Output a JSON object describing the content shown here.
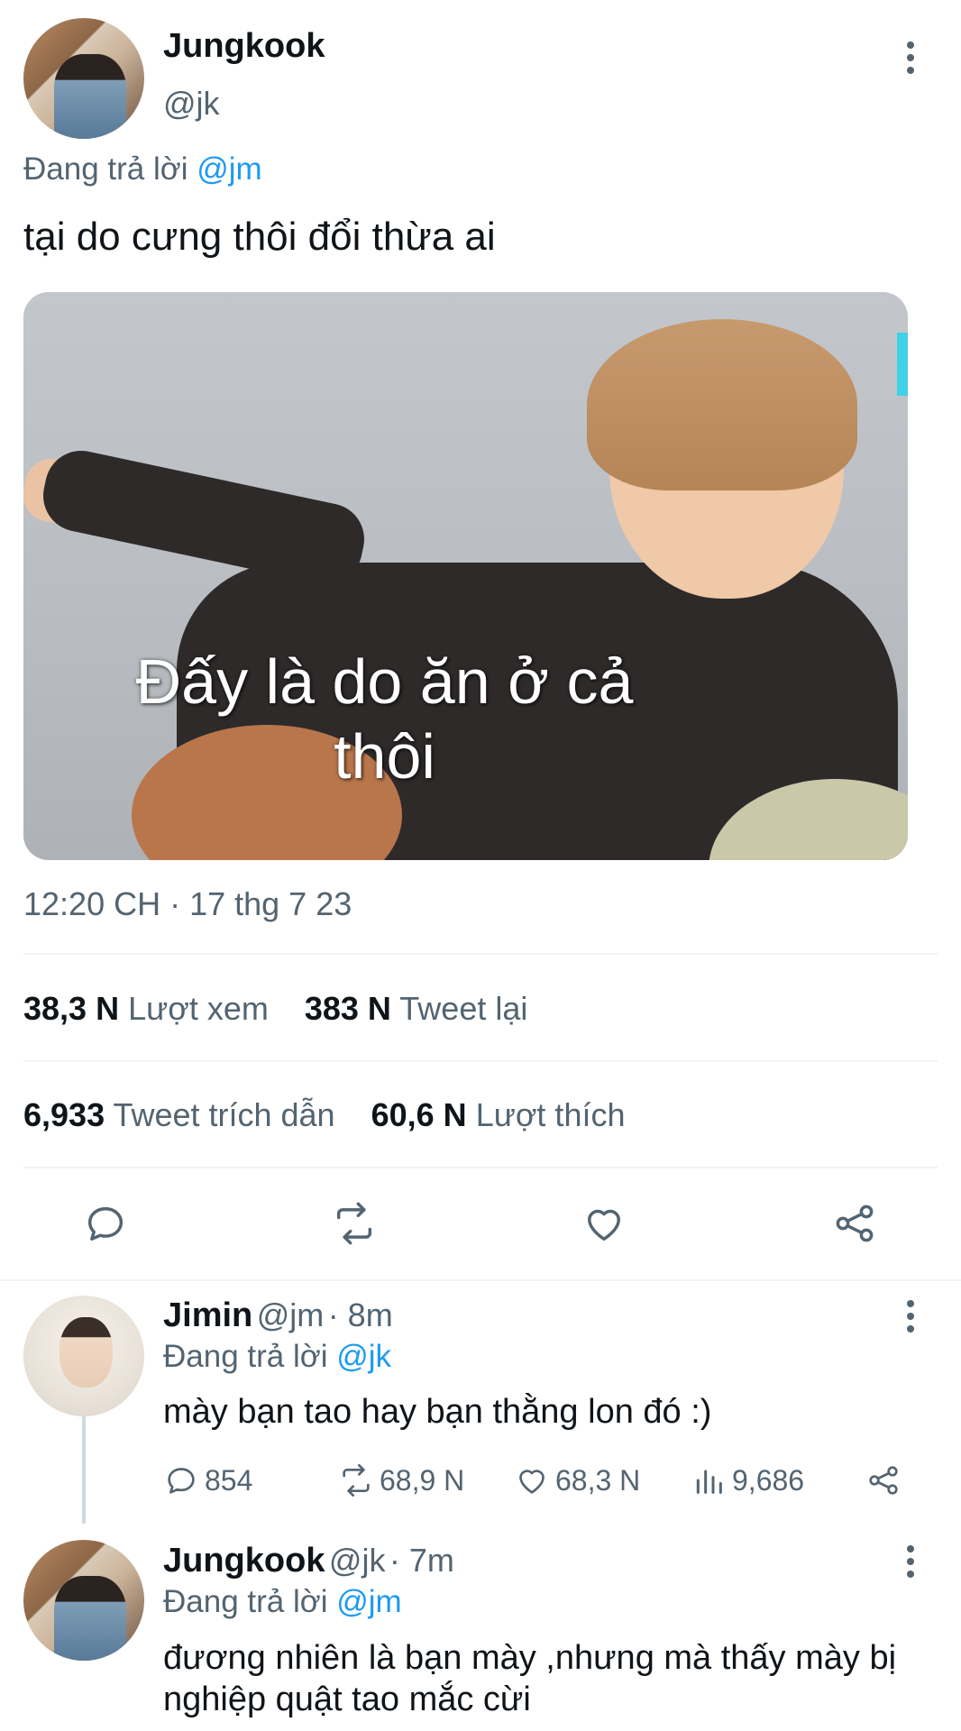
{
  "main_tweet": {
    "author_name": "Jungkook",
    "author_handle": "@jk",
    "reply_prefix": "Đang trả lời",
    "reply_mention": "@jm",
    "text": "tại do cưng thôi đổi thừa ai",
    "media_caption_line1": "Đấy là do ăn ở cả",
    "media_caption_line2": "thôi",
    "timestamp": "12:20 CH · 17 thg 7 23",
    "stats": {
      "views_count": "38,3 N",
      "views_label": "Lượt xem",
      "retweets_count": "383 N",
      "retweets_label": "Tweet lại",
      "quotes_count": "6,933",
      "quotes_label": "Tweet trích dẫn",
      "likes_count": "60,6 N",
      "likes_label": "Lượt thích"
    },
    "icons": [
      "reply-icon",
      "retweet-icon",
      "like-icon",
      "share-icon",
      "more-icon"
    ]
  },
  "replies": [
    {
      "author_name": "Jimin",
      "author_handle": "@jm",
      "time": "· 8m",
      "reply_prefix": "Đang trả lời",
      "reply_mention": "@jk",
      "text": "mày bạn tao hay bạn thằng lon đó :)",
      "reply_count": "854",
      "retweet_count": "68,9 N",
      "like_count": "68,3 N",
      "view_count": "9,686"
    },
    {
      "author_name": "Jungkook",
      "author_handle": "@jk",
      "time": "· 7m",
      "reply_prefix": "Đang trả lời",
      "reply_mention": "@jm",
      "text_line1": "đương nhiên là bạn mày ,nhưng mà thấy mày bị",
      "text_line2": "nghiệp quật tao mắc cừi"
    }
  ],
  "colors": {
    "text_primary": "#0f1419",
    "text_secondary": "#536471",
    "accent": "#1d9bf0",
    "divider": "#eff3f4"
  }
}
